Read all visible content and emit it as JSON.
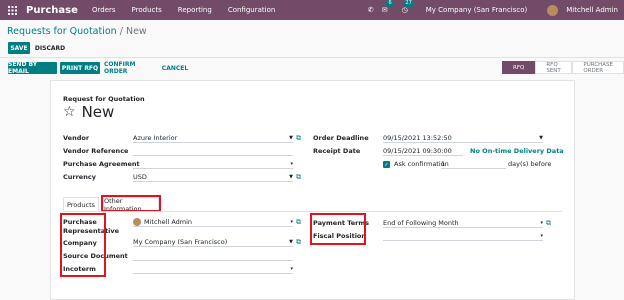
{
  "nav": {
    "brand": "Purchase",
    "menu": [
      "Orders",
      "Products",
      "Reporting",
      "Configuration"
    ],
    "messages_count": "6",
    "activities_count": "27",
    "company": "My Company (San Francisco)",
    "user": "Mitchell Admin"
  },
  "breadcrumb": {
    "parent": "Requests for Quotation",
    "separator": "/",
    "current": "New"
  },
  "actions": {
    "save": "SAVE",
    "discard": "DISCARD"
  },
  "toolbar": {
    "send_email": "SEND BY EMAIL",
    "print_rfq": "PRINT RFQ",
    "confirm": "CONFIRM ORDER",
    "cancel": "CANCEL"
  },
  "status": [
    "RFQ",
    "RFQ SENT",
    "PURCHASE ORDER"
  ],
  "form": {
    "heading": "Request for Quotation",
    "name": "New",
    "vendor_label": "Vendor",
    "vendor_value": "Azure Interior",
    "vendor_ref_label": "Vendor Reference",
    "agreement_label": "Purchase Agreement",
    "currency_label": "Currency",
    "currency_value": "USD",
    "deadline_label": "Order Deadline",
    "deadline_value": "09/15/2021 13:52:50",
    "receipt_label": "Receipt Date",
    "receipt_value": "09/15/2021 09:30:00",
    "on_time": "No On-time Delivery Data",
    "ask_confirm_label": "Ask confirmation",
    "ask_confirm_days": "1",
    "ask_confirm_suffix": "day(s) before"
  },
  "tabs": {
    "products": "Products",
    "other": "Other Information"
  },
  "other": {
    "rep_label_1": "Purchase",
    "rep_label_2": "Representative",
    "rep_value": "Mitchell Admin",
    "company_label": "Company",
    "company_value": "My Company (San Francisco)",
    "source_label": "Source Document",
    "incoterm_label": "Incoterm",
    "payment_terms_label": "Payment Terms",
    "payment_terms_value": "End of Following Month",
    "fiscal_position_label": "Fiscal Position"
  },
  "colors": {
    "brand": "#714b67",
    "accent": "#017e84",
    "highlight": "#e0141e"
  }
}
